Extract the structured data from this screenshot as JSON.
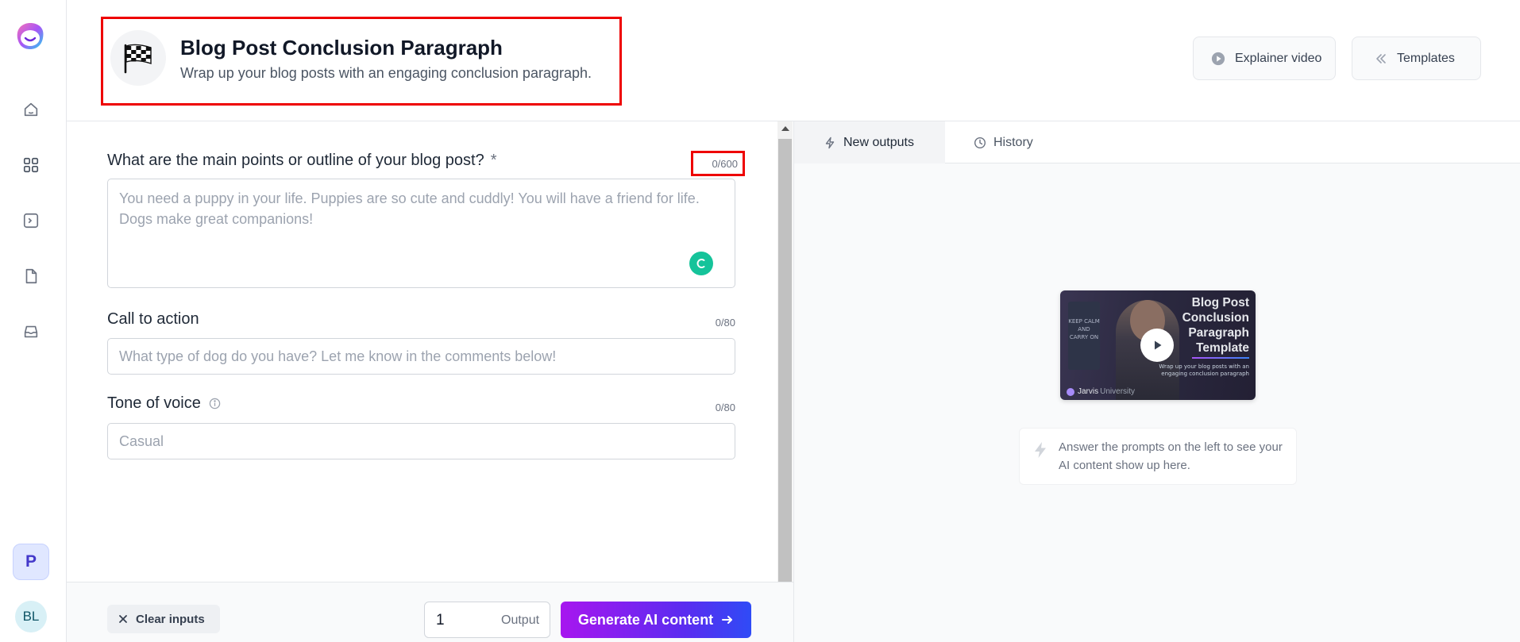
{
  "sidebar": {
    "workspace_initial": "P",
    "user_initials": "BL",
    "nav": [
      "home-icon",
      "apps-grid-icon",
      "terminal-icon",
      "document-icon",
      "inbox-icon"
    ]
  },
  "header": {
    "title": "Blog Post Conclusion Paragraph",
    "subtitle": "Wrap up your blog posts with an engaging conclusion paragraph.",
    "explainer_label": "Explainer video",
    "templates_label": "Templates"
  },
  "form": {
    "outline": {
      "label": "What are the main points or outline of your blog post?",
      "required_mark": "*",
      "count": "0/600",
      "placeholder": "You need a puppy in your life. Puppies are so cute and cuddly! You will have a friend for life. Dogs make great companions!"
    },
    "cta": {
      "label": "Call to action",
      "count": "0/80",
      "placeholder": "What type of dog do you have? Let me know in the comments below!"
    },
    "tone": {
      "label": "Tone of voice",
      "count": "0/80",
      "placeholder": "Casual"
    }
  },
  "footer": {
    "clear_label": "Clear inputs",
    "output_count": "1",
    "output_label": "Output",
    "generate_label": "Generate AI content"
  },
  "outputs": {
    "tab_new": "New outputs",
    "tab_history": "History",
    "video": {
      "title": "Blog Post Conclusion Paragraph Template",
      "subtitle": "Wrap up your blog posts with an engaging conclusion paragraph",
      "sign_text": "KEEP CALM AND CARRY ON",
      "brand": "Jarvis",
      "brand_suffix": "University"
    },
    "hint": "Answer the prompts on the left to see your AI content show up here."
  },
  "colors": {
    "accent_gradient_start": "#a716ef",
    "accent_gradient_end": "#2f4bf6",
    "highlight": "#ee0000"
  }
}
